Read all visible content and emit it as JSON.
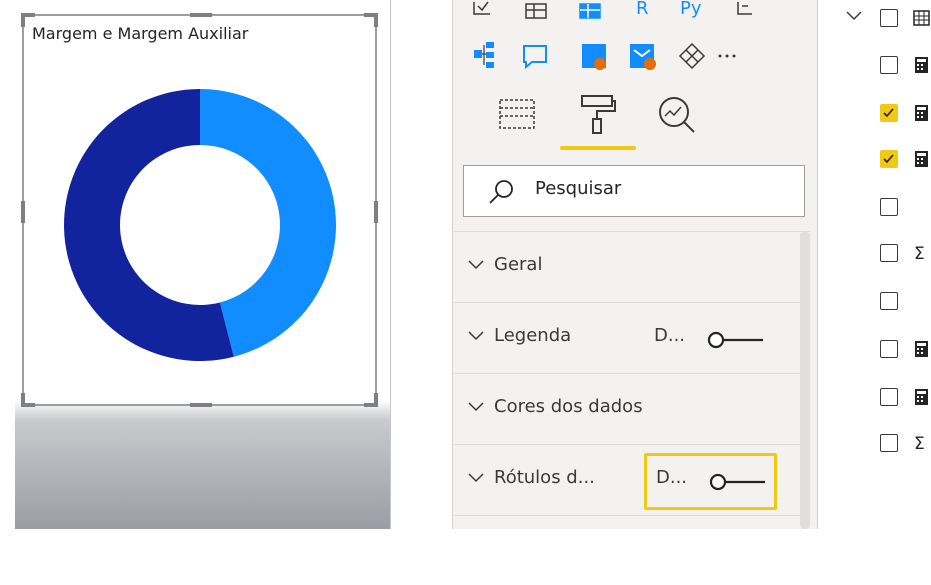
{
  "visual": {
    "title": "Margem e Margem Auxiliar"
  },
  "chart_data": {
    "type": "pie",
    "title": "Margem e Margem Auxiliar",
    "labels": [
      "",
      ""
    ],
    "values": [
      46,
      54
    ],
    "colors": [
      "#118dff",
      "#12239e"
    ],
    "donut": true
  },
  "format_pane": {
    "tabs": [
      {
        "icon": "fields-tab-icon",
        "active": false
      },
      {
        "icon": "paint-roller-icon",
        "active": true
      },
      {
        "icon": "analytics-magnifier-icon",
        "active": false
      }
    ],
    "search": {
      "placeholder": "Pesquisar"
    },
    "sections": [
      {
        "label": "Geral",
        "value": "",
        "toggle": false
      },
      {
        "label": "Legenda",
        "value": "D...",
        "toggle": true
      },
      {
        "label": "Cores dos dados",
        "value": "",
        "toggle": false
      },
      {
        "label": "Rótulos d...",
        "value": "D...",
        "toggle": true
      }
    ],
    "accent": "#f2c811"
  },
  "fields_pane": {
    "items": [
      {
        "checked": false,
        "icon": "table-icon",
        "expanded": true
      },
      {
        "checked": false,
        "icon": "calculator-icon"
      },
      {
        "checked": true,
        "icon": "calculator-icon"
      },
      {
        "checked": true,
        "icon": "calculator-icon"
      },
      {
        "checked": false,
        "icon": ""
      },
      {
        "checked": false,
        "icon": "sigma-icon"
      },
      {
        "checked": false,
        "icon": ""
      },
      {
        "checked": false,
        "icon": "calculator-icon"
      },
      {
        "checked": false,
        "icon": "calculator-icon"
      },
      {
        "checked": false,
        "icon": "sigma-icon"
      }
    ]
  }
}
